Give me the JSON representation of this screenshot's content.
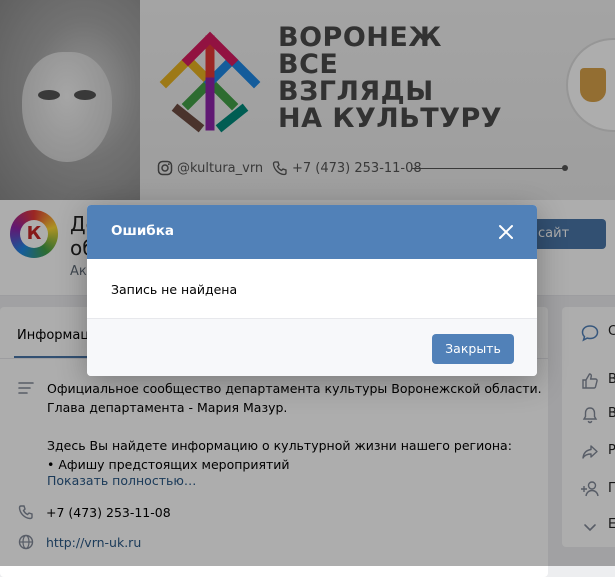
{
  "banner": {
    "logo_lines": [
      "ВОРОНЕЖ",
      "ВСЕ",
      "ВЗГЛЯДЫ",
      "НА КУЛЬТУРУ"
    ],
    "instagram_handle": "@kultura_vrn",
    "phone": "+7 (473) 253-11-08"
  },
  "profile": {
    "name": "Де\nоб",
    "status": "Ак",
    "site_button_label": "сайт",
    "avatar_letter": "К"
  },
  "info": {
    "tab_label": "Информаци",
    "description_lines": [
      "Официальное сообщество департамента культуры Воронежской области.",
      "Глава департамента - Мария Мазур.",
      "",
      "Здесь Вы найдете информацию о культурной жизни нашего региона:",
      "• Афишу предстоящих мероприятий"
    ],
    "show_more": "Показать полностью…",
    "phone": "+7 (473) 253-11-08",
    "website": "http://vrn-uk.ru"
  },
  "side_menu": {
    "letters": [
      "С",
      "В",
      "В",
      "Р",
      "П",
      "Е"
    ]
  },
  "modal": {
    "title": "Ошибка",
    "message": "Запись не найдена",
    "close_button_label": "Закрыть"
  },
  "colors": {
    "accent": "#5181b8",
    "link": "#2a5885",
    "page_bg": "#edeef0"
  }
}
